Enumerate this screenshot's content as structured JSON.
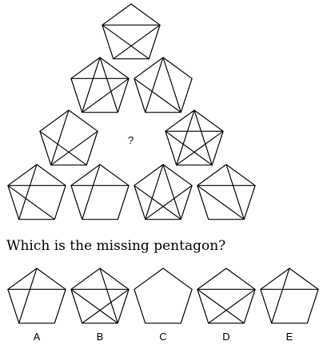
{
  "puzzle": {
    "question_mark": "?",
    "pentagons": [
      {
        "id": "r1-1",
        "diagonals": [
          "BE",
          "BD",
          "CE"
        ]
      },
      {
        "id": "r2-1",
        "diagonals": [
          "AC",
          "AD",
          "BE",
          "BD"
        ]
      },
      {
        "id": "r2-2",
        "diagonals": [
          "AC",
          "AD",
          "CE"
        ]
      },
      {
        "id": "r3-1",
        "diagonals": [
          "AD",
          "BD",
          "CE"
        ]
      },
      {
        "id": "r3-3",
        "diagonals": [
          "AC",
          "AD",
          "BE",
          "BD",
          "CE"
        ]
      },
      {
        "id": "r4-1",
        "diagonals": [
          "AD",
          "BE",
          "CE"
        ]
      },
      {
        "id": "r4-2",
        "diagonals": [
          "AD",
          "BE"
        ]
      },
      {
        "id": "r4-3",
        "diagonals": [
          "AD",
          "BD",
          "CE",
          "AC"
        ]
      },
      {
        "id": "r4-4",
        "diagonals": [
          "AC",
          "BE",
          "CE"
        ]
      }
    ]
  },
  "question": {
    "text": "Which is the missing pentagon?"
  },
  "options": [
    {
      "label": "A",
      "diagonals": [
        "AD",
        "BE"
      ]
    },
    {
      "label": "B",
      "diagonals": [
        "AC",
        "BE",
        "BD",
        "CE"
      ]
    },
    {
      "label": "C",
      "diagonals": []
    },
    {
      "label": "D",
      "diagonals": [
        "BE",
        "BD",
        "CE"
      ]
    },
    {
      "label": "E",
      "diagonals": [
        "AD",
        "BE"
      ]
    }
  ]
}
